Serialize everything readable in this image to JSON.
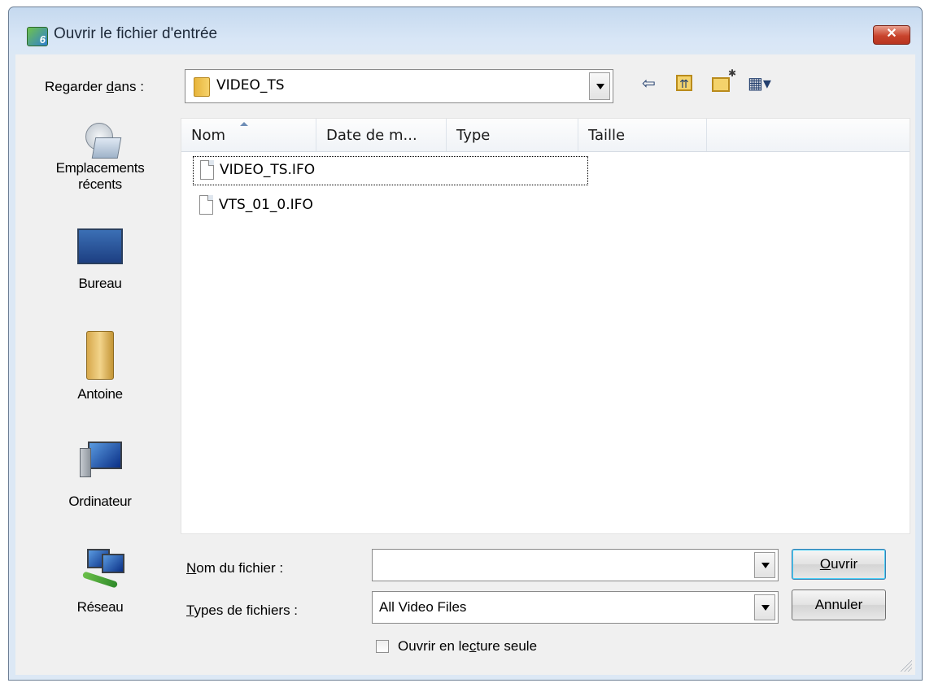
{
  "window": {
    "title": "Ouvrir le fichier d'entrée",
    "close_label": "✕",
    "app_icon_glyph": "6"
  },
  "look_in": {
    "label_pre": "Regarder ",
    "label_key": "d",
    "label_post": "ans :",
    "value": "VIDEO_TS"
  },
  "toolbar": {
    "back_icon": "⇦",
    "up_icon": "⇈",
    "new_folder_icon": "✱",
    "views_icon": "▦▾"
  },
  "places": [
    {
      "label_line1": "Emplacements",
      "label_line2": "récents",
      "icon": "recent-places-icon"
    },
    {
      "label_line1": "Bureau",
      "label_line2": "",
      "icon": "desktop-icon"
    },
    {
      "label_line1": "Antoine",
      "label_line2": "",
      "icon": "user-folder-icon"
    },
    {
      "label_line1": "Ordinateur",
      "label_line2": "",
      "icon": "computer-icon"
    },
    {
      "label_line1": "Réseau",
      "label_line2": "",
      "icon": "network-icon"
    }
  ],
  "columns": [
    "Nom",
    "Date de m...",
    "Type",
    "Taille"
  ],
  "files": [
    {
      "name": "VIDEO_TS.IFO"
    },
    {
      "name": "VTS_01_0.IFO"
    }
  ],
  "filename": {
    "label_key": "N",
    "label_post": "om du fichier :",
    "value": ""
  },
  "filetype": {
    "label_key": "T",
    "label_post": "ypes de fichiers :",
    "value": "All Video Files"
  },
  "readonly": {
    "label_pre": "Ouvrir en le",
    "label_key": "c",
    "label_post": "ture seule",
    "checked": false
  },
  "buttons": {
    "open_key": "O",
    "open_post": "uvrir",
    "cancel": "Annuler"
  }
}
